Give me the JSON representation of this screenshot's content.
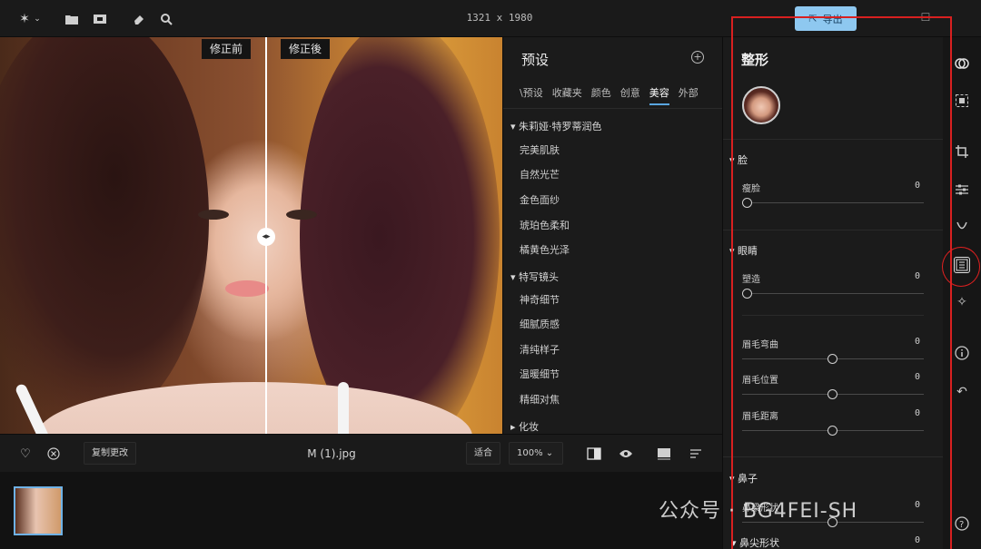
{
  "toolbar": {
    "app_icon": "sparkle-icon",
    "image_dimensions": "1321 x 1980",
    "export_label": "导出"
  },
  "canvas": {
    "before_label": "修正前",
    "after_label": "修正後"
  },
  "presets": {
    "title": "预设",
    "tabs": [
      "\\预设",
      "收藏夹",
      "颜色",
      "创意",
      "美容",
      "外部"
    ],
    "active_tab": "美容",
    "groups": [
      {
        "name": "朱莉娅·特罗蒂润色",
        "expanded": true,
        "items": [
          "完美肌肤",
          "自然光芒",
          "金色面纱",
          "琥珀色柔和",
          "橘黄色光泽"
        ]
      },
      {
        "name": "特写镜头",
        "expanded": true,
        "items": [
          "神奇细节",
          "细腻质感",
          "清纯样子",
          "温暖细节",
          "精细对焦"
        ]
      },
      {
        "name": "化妆",
        "expanded": false,
        "items": []
      }
    ]
  },
  "reshape": {
    "title": "整形",
    "sections": [
      {
        "name": "脸",
        "sliders": [
          {
            "label": "瘦脸",
            "value": "0"
          }
        ]
      },
      {
        "name": "眼睛",
        "sliders": [
          {
            "label": "塑造",
            "value": "0"
          },
          {
            "label": "眉毛弯曲",
            "value": "0"
          },
          {
            "label": "眉毛位置",
            "value": "0"
          },
          {
            "label": "眉毛距离",
            "value": "0"
          }
        ]
      },
      {
        "name": "鼻子",
        "sliders": [
          {
            "label": "鼻梁形状",
            "value": "0"
          },
          {
            "label": "鼻尖形状",
            "value": "0"
          }
        ]
      }
    ]
  },
  "bottombar": {
    "copy_changes_label": "复制更改",
    "filename": "M (1).jpg",
    "fit_label": "适合",
    "zoom_label": "100%"
  },
  "watermark": "公众号 · BG4FEI-SH",
  "colors": {
    "accent": "#8ec8f0",
    "annotation_red": "#d82020"
  }
}
